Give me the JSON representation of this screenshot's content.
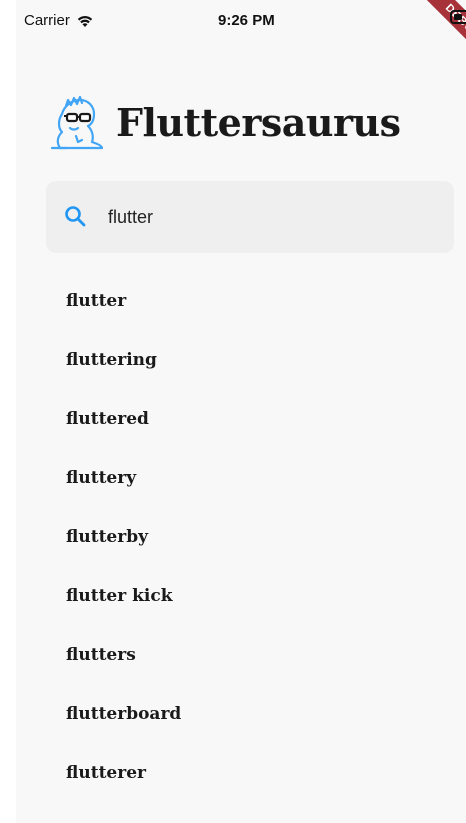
{
  "status_bar": {
    "carrier": "Carrier",
    "time": "9:26 PM",
    "debug_label": "DEBUG"
  },
  "header": {
    "title": "Fluttersaurus",
    "logo_icon": "dinosaur-mascot-icon"
  },
  "search": {
    "value": "flutter",
    "icon": "search-icon",
    "accent_color": "#2196f3"
  },
  "results": [
    {
      "label": "flutter"
    },
    {
      "label": "fluttering"
    },
    {
      "label": "fluttered"
    },
    {
      "label": "fluttery"
    },
    {
      "label": "flutterby"
    },
    {
      "label": "flutter kick"
    },
    {
      "label": "flutters"
    },
    {
      "label": "flutterboard"
    },
    {
      "label": "flutterer"
    }
  ]
}
